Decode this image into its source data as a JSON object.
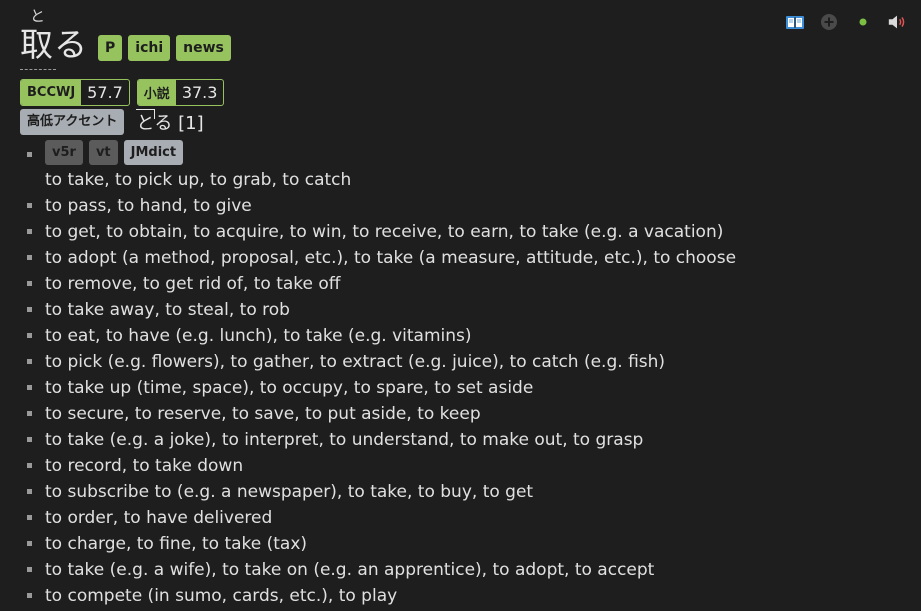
{
  "actions": [
    "add-to-deck-icon",
    "add-note-icon",
    "status-dot-icon",
    "play-audio-icon"
  ],
  "colors": {
    "background": "#1e1e1e",
    "tag_green": "#97c35f",
    "tag_grey": "#5b5b5b",
    "tag_blue": "#a8adb3"
  },
  "headword": {
    "furigana": "と",
    "kanji": "取る",
    "tags": [
      "P",
      "ichi",
      "news"
    ]
  },
  "frequencies": [
    {
      "label": "BCCWJ",
      "value": "57.7"
    },
    {
      "label": "小説",
      "value": "37.3"
    }
  ],
  "pitch": {
    "tag": "高低アクセント",
    "reading": "とる",
    "accent": "[1]"
  },
  "definitions": {
    "first_tags": [
      "v5r",
      "vt",
      "JMdict"
    ],
    "items": [
      "to take, to pick up, to grab, to catch",
      "to pass, to hand, to give",
      "to get, to obtain, to acquire, to win, to receive, to earn, to take (e.g. a vacation)",
      "to adopt (a method, proposal, etc.), to take (a measure, attitude, etc.), to choose",
      "to remove, to get rid of, to take off",
      "to take away, to steal, to rob",
      "to eat, to have (e.g. lunch), to take (e.g. vitamins)",
      "to pick (e.g. flowers), to gather, to extract (e.g. juice), to catch (e.g. fish)",
      "to take up (time, space), to occupy, to spare, to set aside",
      "to secure, to reserve, to save, to put aside, to keep",
      "to take (e.g. a joke), to interpret, to understand, to make out, to grasp",
      "to record, to take down",
      "to subscribe to (e.g. a newspaper), to take, to buy, to get",
      "to order, to have delivered",
      "to charge, to fine, to take (tax)",
      "to take (e.g. a wife), to take on (e.g. an apprentice), to adopt, to accept",
      "to compete (in sumo, cards, etc.), to play"
    ]
  }
}
